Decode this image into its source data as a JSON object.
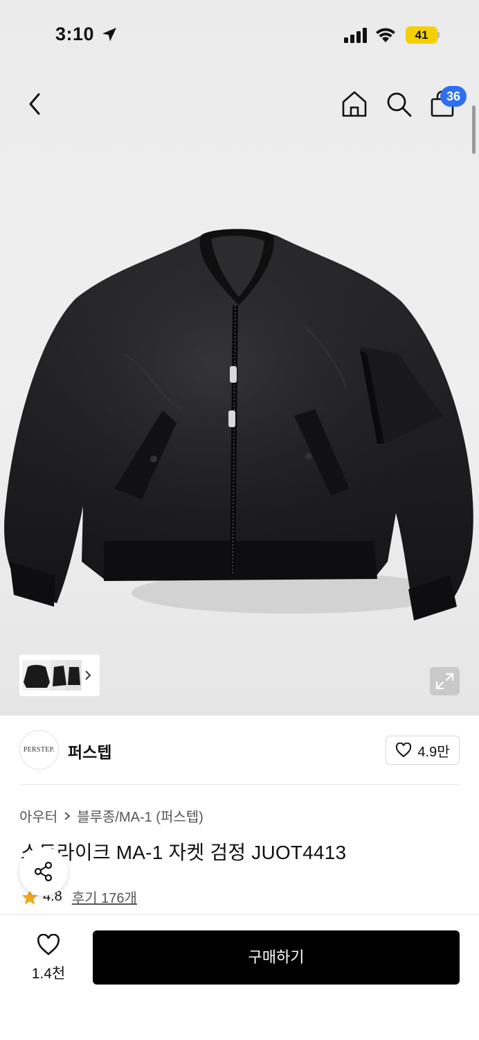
{
  "status_bar": {
    "time": "3:10",
    "battery": "41"
  },
  "nav": {
    "cart_count": "36"
  },
  "brand": {
    "logo_text": "PERSTEP.",
    "name": "퍼스텝",
    "likes": "4.9만"
  },
  "product": {
    "category": "아우터",
    "subcategory": "블루종/MA-1 (퍼스텝)",
    "title": "스트라이크 MA-1 자켓 검정 JUOT4413",
    "rating": "4.8",
    "reviews": "후기 176개"
  },
  "bottom": {
    "fav_count": "1.4천",
    "buy_label": "구매하기"
  },
  "colors": {
    "accent": "#2e6ff2",
    "star": "#f2a81d",
    "battery": "#f5d000",
    "buy_button": "#000000"
  }
}
